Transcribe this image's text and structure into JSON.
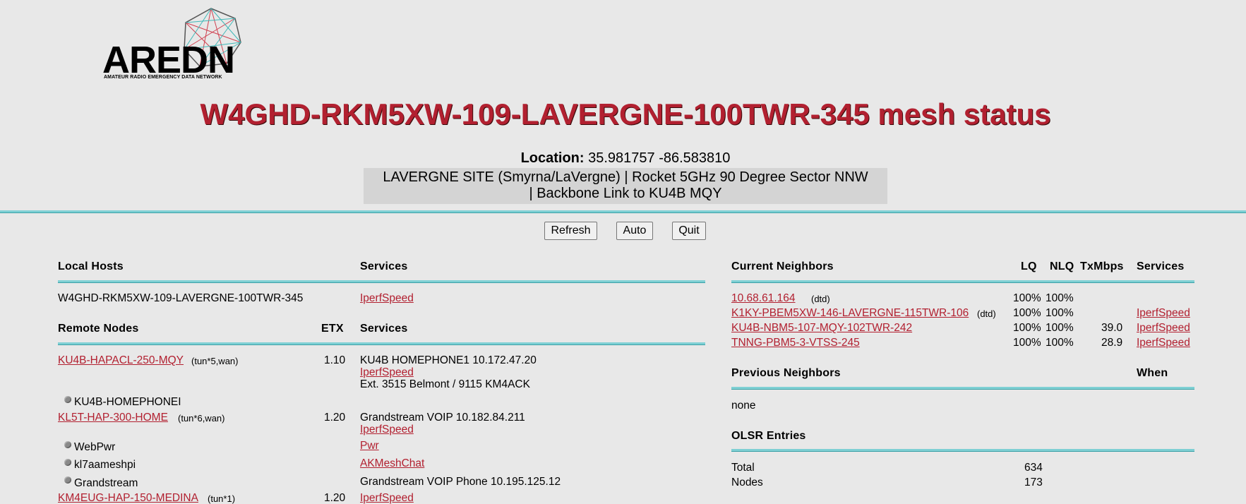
{
  "logo": {
    "word": "AREDN",
    "tm": "™",
    "subtitle": "AMATEUR RADIO EMERGENCY DATA NETWORK"
  },
  "title": "W4GHD-RKM5XW-109-LAVERGNE-100TWR-345 mesh status",
  "location": {
    "label": "Location:",
    "value": "35.981757 -86.583810"
  },
  "description": {
    "line1": "LAVERGNE SITE (Smyrna/LaVergne) | Rocket 5GHz 90 Degree Sector NNW",
    "line2": "| Backbone Link to KU4B MQY"
  },
  "buttons": {
    "refresh": "Refresh",
    "auto": "Auto",
    "quit": "Quit"
  },
  "local_hosts": {
    "header": "Local Hosts",
    "services_header": "Services",
    "host": "W4GHD-RKM5XW-109-LAVERGNE-100TWR-345",
    "service": "IperfSpeed"
  },
  "remote_nodes": {
    "header": "Remote Nodes",
    "etx_header": "ETX",
    "services_header": "Services",
    "rows": [
      {
        "name": "KU4B-HAPACL-250-MQY",
        "tag": "(tun*5,wan)",
        "etx": "1.10",
        "services": [
          "KU4B HOMEPHONE1 10.172.47.20",
          "IperfSpeed",
          "Ext. 3515 Belmont / 9115 KM4ACK"
        ],
        "hosts": [
          "KU4B-HOMEPHONEI"
        ]
      },
      {
        "name": "KL5T-HAP-300-HOME",
        "tag": "(tun*6,wan)",
        "etx": "1.20",
        "services": [
          "Grandstream VOIP 10.182.84.211",
          "IperfSpeed"
        ],
        "hosts": [
          "WebPwr",
          "kl7aameshpi",
          "Grandstream"
        ],
        "host_services": [
          "Pwr",
          "AKMeshChat",
          "Grandstream VOIP Phone 10.195.125.12"
        ]
      },
      {
        "name": "KM4EUG-HAP-150-MEDINA",
        "tag": "(tun*1)",
        "etx": "1.20",
        "services": [
          "IperfSpeed"
        ]
      }
    ]
  },
  "current_neighbors": {
    "header": "Current Neighbors",
    "lq_header": "LQ",
    "nlq_header": "NLQ",
    "tx_header": "TxMbps",
    "services_header": "Services",
    "rows": [
      {
        "name": "10.68.61.164",
        "tag": "(dtd)",
        "lq": "100%",
        "nlq": "100%",
        "tx": "",
        "service": ""
      },
      {
        "name": "K1KY-PBEM5XW-146-LAVERGNE-115TWR-106",
        "tag": "(dtd)",
        "lq": "100%",
        "nlq": "100%",
        "tx": "",
        "service": "IperfSpeed"
      },
      {
        "name": "KU4B-NBM5-107-MQY-102TWR-242",
        "tag": "",
        "lq": "100%",
        "nlq": "100%",
        "tx": "39.0",
        "service": "IperfSpeed"
      },
      {
        "name": "TNNG-PBM5-3-VTSS-245",
        "tag": "",
        "lq": "100%",
        "nlq": "100%",
        "tx": "28.9",
        "service": "IperfSpeed"
      }
    ]
  },
  "previous_neighbors": {
    "header": "Previous Neighbors",
    "when_header": "When",
    "value": "none"
  },
  "olsr": {
    "header": "OLSR Entries",
    "rows": [
      {
        "label": "Total",
        "value": "634"
      },
      {
        "label": "Nodes",
        "value": "173"
      }
    ]
  },
  "colors": {
    "accent_red": "#b22030",
    "rule_teal": "#7fd0d4",
    "background": "#e8e8e8"
  }
}
